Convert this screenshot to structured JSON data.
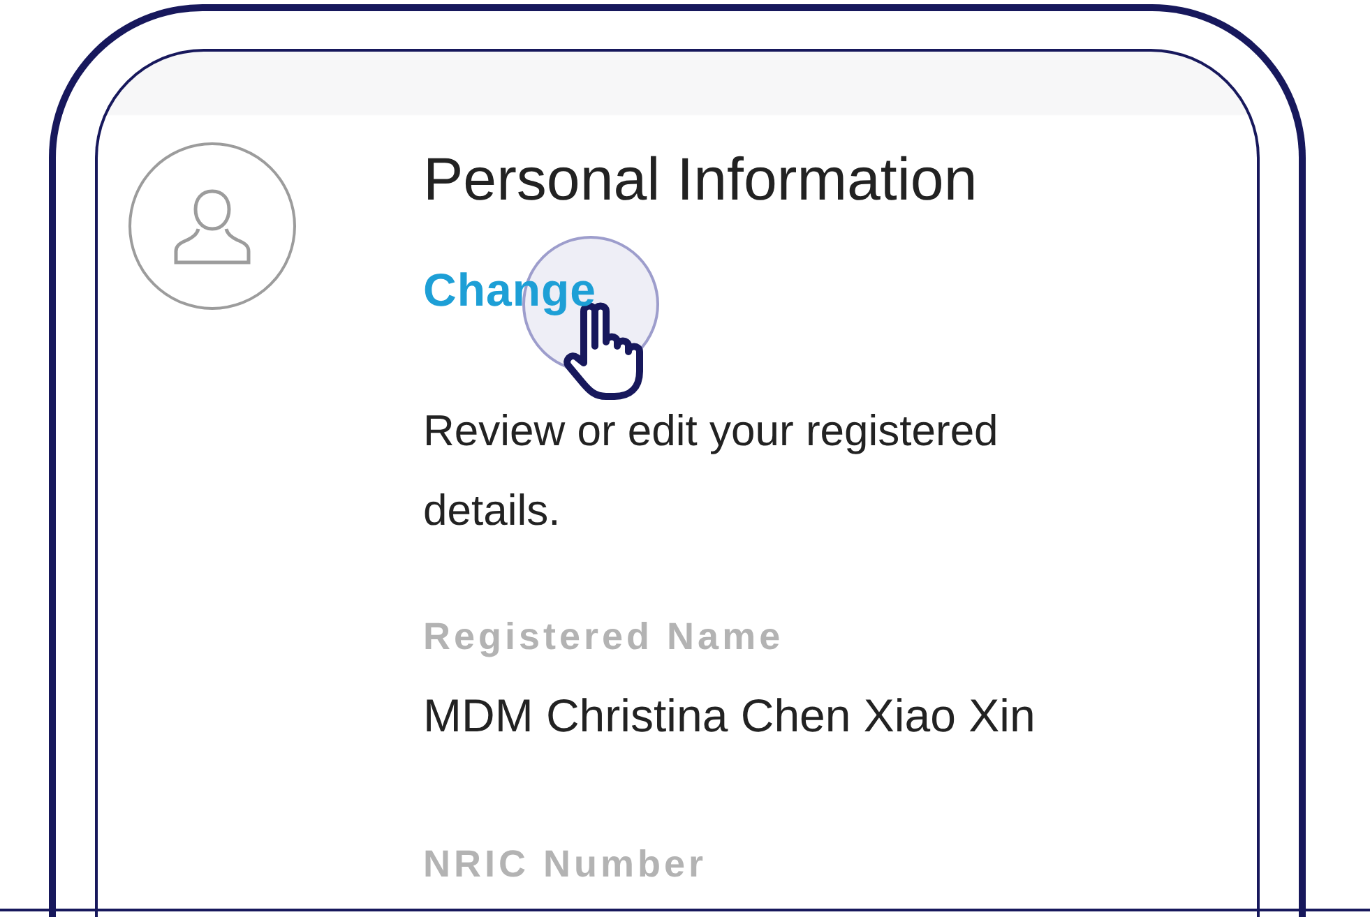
{
  "section": {
    "title": "Personal Information",
    "action": "Change",
    "description": "Review or edit your registered details."
  },
  "fields": [
    {
      "label": "Registered Name",
      "value": "MDM Christina Chen Xiao Xin"
    },
    {
      "label": "NRIC Number"
    }
  ]
}
